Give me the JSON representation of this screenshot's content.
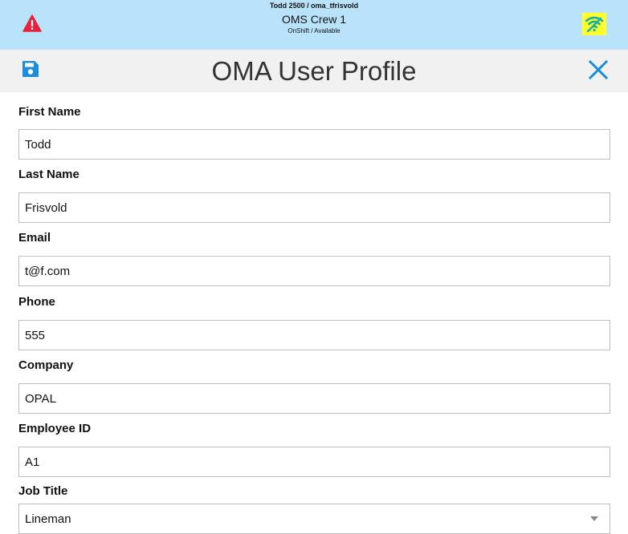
{
  "status_bar": {
    "user": "Todd 2500 / oma_tfrisvold",
    "crew": "OMS Crew 1",
    "shift": "OnShift / Available",
    "alert_icon": "alert-triangle-icon",
    "wifi_icon": "wifi-icon",
    "alert_color": "#e8203a",
    "wifi_highlight": "#ffff2e"
  },
  "header": {
    "title": "OMA User Profile",
    "save_icon": "save-icon",
    "close_icon": "close-icon",
    "accent": "#1a8fd8"
  },
  "form": {
    "first_name": {
      "label": "First Name",
      "value": "Todd"
    },
    "last_name": {
      "label": "Last Name",
      "value": "Frisvold"
    },
    "email": {
      "label": "Email",
      "value": "t@f.com"
    },
    "phone": {
      "label": "Phone",
      "value": "555"
    },
    "company": {
      "label": "Company",
      "value": "OPAL"
    },
    "employee_id": {
      "label": "Employee ID",
      "value": "A1"
    },
    "job_title": {
      "label": "Job Title",
      "value": "Lineman"
    }
  }
}
